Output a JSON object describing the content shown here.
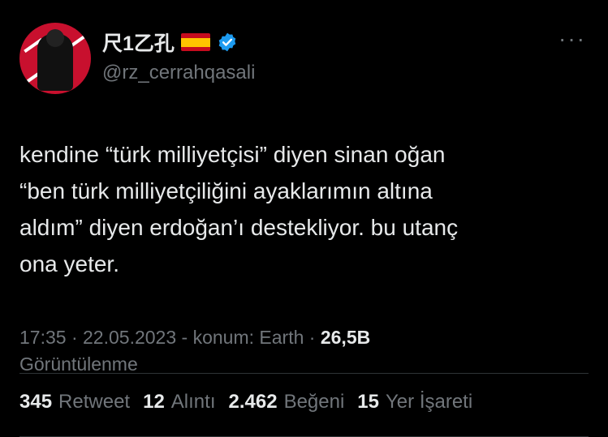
{
  "author": {
    "display_name": "尺1乙孔",
    "flag": "spain-flag",
    "verified_icon": "verified-badge-icon",
    "handle": "@rz_cerrahqasali"
  },
  "more_icon": "more-options-icon",
  "more_label": "···",
  "tweet": {
    "text": "kendine “türk milliyetçisi” diyen sinan oğan\n“ben türk milliyetçiliğini ayaklarımın altına\naldım” diyen erdoğan’ı destekliyor. bu utanç\nona yeter."
  },
  "meta": {
    "time": "17:35",
    "sep1": " · ",
    "date": "22.05.2023",
    "sep2": " - ",
    "location": "konum: Earth",
    "sep3": " · ",
    "views_count": "26,5B",
    "views_label": "Görüntülenme"
  },
  "stats": [
    {
      "num": "345",
      "label": "Retweet"
    },
    {
      "num": "12",
      "label": "Alıntı"
    },
    {
      "num": "2.462",
      "label": "Beğeni"
    },
    {
      "num": "15",
      "label": "Yer İşareti"
    }
  ],
  "colors": {
    "background": "#000000",
    "text": "#e7e9ea",
    "muted": "#71767b",
    "verified": "#1d9bf0"
  }
}
